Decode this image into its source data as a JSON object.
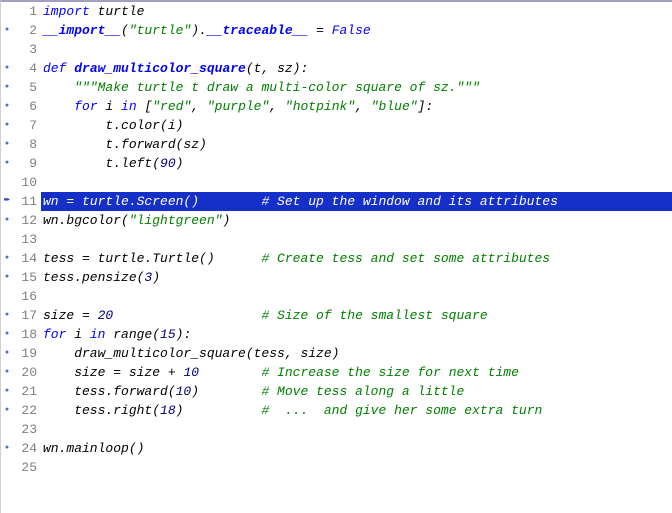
{
  "lines": [
    {
      "n": 1,
      "marker": "",
      "seg": [
        [
          "kw",
          "import"
        ],
        [
          "plain",
          " turtle"
        ]
      ]
    },
    {
      "n": 2,
      "marker": "•",
      "seg": [
        [
          "fn",
          "__import__"
        ],
        [
          "plain",
          "("
        ],
        [
          "str",
          "\"turtle\""
        ],
        [
          "plain",
          ")."
        ],
        [
          "fn bold",
          "__traceable__"
        ],
        [
          "plain",
          " = "
        ],
        [
          "kw",
          "False"
        ]
      ]
    },
    {
      "n": 3,
      "marker": "",
      "seg": []
    },
    {
      "n": 4,
      "marker": "•",
      "seg": [
        [
          "kw",
          "def "
        ],
        [
          "fn",
          "draw_multicolor_square"
        ],
        [
          "plain",
          "(t, sz):"
        ]
      ]
    },
    {
      "n": 5,
      "marker": "•",
      "seg": [
        [
          "plain",
          "    "
        ],
        [
          "str",
          "\"\"\"Make turtle t draw a multi-color square of sz.\"\"\""
        ]
      ]
    },
    {
      "n": 6,
      "marker": "•",
      "seg": [
        [
          "plain",
          "    "
        ],
        [
          "kw",
          "for"
        ],
        [
          "plain",
          " i "
        ],
        [
          "kw",
          "in"
        ],
        [
          "plain",
          " ["
        ],
        [
          "str",
          "\"red\""
        ],
        [
          "plain",
          ", "
        ],
        [
          "str",
          "\"purple\""
        ],
        [
          "plain",
          ", "
        ],
        [
          "str",
          "\"hotpink\""
        ],
        [
          "plain",
          ", "
        ],
        [
          "str",
          "\"blue\""
        ],
        [
          "plain",
          "]:"
        ]
      ]
    },
    {
      "n": 7,
      "marker": "•",
      "seg": [
        [
          "plain",
          "        t.color(i)"
        ]
      ]
    },
    {
      "n": 8,
      "marker": "•",
      "seg": [
        [
          "plain",
          "        t.forward(sz)"
        ]
      ]
    },
    {
      "n": 9,
      "marker": "•",
      "seg": [
        [
          "plain",
          "        t.left("
        ],
        [
          "num",
          "90"
        ],
        [
          "plain",
          ")"
        ]
      ]
    },
    {
      "n": 10,
      "marker": "",
      "seg": []
    },
    {
      "n": 11,
      "marker": "➨",
      "hl": true,
      "seg": [
        [
          "plain",
          "wn = turtle.Screen()        "
        ],
        [
          "comment",
          "# Set up the window and its attributes"
        ]
      ]
    },
    {
      "n": 12,
      "marker": "•",
      "seg": [
        [
          "plain",
          "wn.bgcolor("
        ],
        [
          "str",
          "\"lightgreen\""
        ],
        [
          "plain",
          ")"
        ]
      ]
    },
    {
      "n": 13,
      "marker": "",
      "seg": []
    },
    {
      "n": 14,
      "marker": "•",
      "seg": [
        [
          "plain",
          "tess = turtle.Turtle()      "
        ],
        [
          "comment",
          "# Create tess and set some attributes"
        ]
      ]
    },
    {
      "n": 15,
      "marker": "•",
      "seg": [
        [
          "plain",
          "tess.pensize("
        ],
        [
          "num",
          "3"
        ],
        [
          "plain",
          ")"
        ]
      ]
    },
    {
      "n": 16,
      "marker": "",
      "seg": []
    },
    {
      "n": 17,
      "marker": "•",
      "seg": [
        [
          "plain",
          "size = "
        ],
        [
          "num",
          "20"
        ],
        [
          "plain",
          "                   "
        ],
        [
          "comment",
          "# Size of the smallest square"
        ]
      ]
    },
    {
      "n": 18,
      "marker": "•",
      "seg": [
        [
          "kw",
          "for"
        ],
        [
          "plain",
          " i "
        ],
        [
          "kw",
          "in"
        ],
        [
          "plain",
          " range("
        ],
        [
          "num",
          "15"
        ],
        [
          "plain",
          "):"
        ]
      ]
    },
    {
      "n": 19,
      "marker": "•",
      "seg": [
        [
          "plain",
          "    draw_multicolor_square(tess, size)"
        ]
      ]
    },
    {
      "n": 20,
      "marker": "•",
      "seg": [
        [
          "plain",
          "    size = size + "
        ],
        [
          "num",
          "10"
        ],
        [
          "plain",
          "        "
        ],
        [
          "comment",
          "# Increase the size for next time"
        ]
      ]
    },
    {
      "n": 21,
      "marker": "•",
      "seg": [
        [
          "plain",
          "    tess.forward("
        ],
        [
          "num",
          "10"
        ],
        [
          "plain",
          ")        "
        ],
        [
          "comment",
          "# Move tess along a little"
        ]
      ]
    },
    {
      "n": 22,
      "marker": "•",
      "seg": [
        [
          "plain",
          "    tess.right("
        ],
        [
          "num",
          "18"
        ],
        [
          "plain",
          ")          "
        ],
        [
          "comment",
          "#  ...  and give her some extra turn"
        ]
      ]
    },
    {
      "n": 23,
      "marker": "",
      "seg": []
    },
    {
      "n": 24,
      "marker": "•",
      "seg": [
        [
          "plain",
          "wn.mainloop()"
        ]
      ]
    },
    {
      "n": 25,
      "marker": "",
      "seg": []
    }
  ]
}
